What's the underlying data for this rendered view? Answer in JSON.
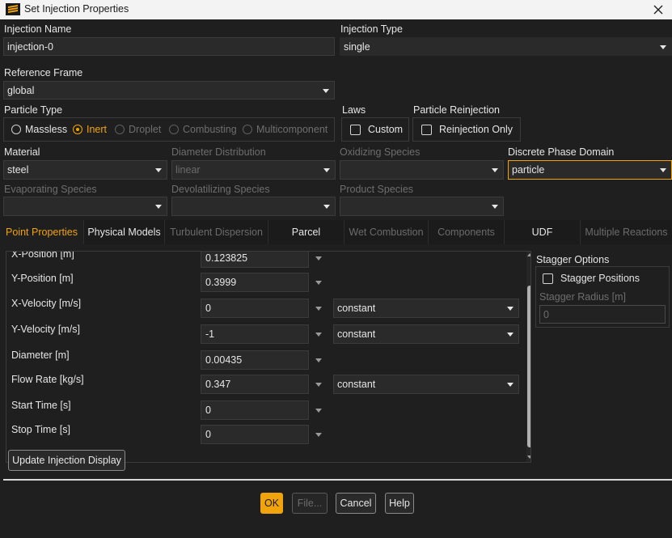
{
  "window": {
    "title": "Set Injection Properties"
  },
  "injection_name": {
    "label": "Injection Name",
    "value": "injection-0"
  },
  "injection_type": {
    "label": "Injection Type",
    "value": "single"
  },
  "reference_frame": {
    "label": "Reference Frame",
    "value": "global"
  },
  "particle_type": {
    "label": "Particle Type",
    "options": [
      "Massless",
      "Inert",
      "Droplet",
      "Combusting",
      "Multicomponent"
    ],
    "selected": "Inert"
  },
  "laws": {
    "label": "Laws",
    "custom_label": "Custom"
  },
  "particle_reinjection": {
    "label": "Particle Reinjection",
    "reinjection_only_label": "Reinjection Only"
  },
  "material": {
    "label": "Material",
    "value": "steel"
  },
  "diameter_distribution": {
    "label": "Diameter Distribution",
    "value": "linear"
  },
  "oxidizing_species": {
    "label": "Oxidizing Species",
    "value": ""
  },
  "discrete_phase_domain": {
    "label": "Discrete Phase Domain",
    "value": "particle"
  },
  "evaporating_species": {
    "label": "Evaporating Species",
    "value": ""
  },
  "devolatilizing_species": {
    "label": "Devolatilizing Species",
    "value": ""
  },
  "product_species": {
    "label": "Product Species",
    "value": ""
  },
  "tabs": [
    {
      "label": "Point Properties",
      "state": "active"
    },
    {
      "label": "Physical Models",
      "state": "enabled"
    },
    {
      "label": "Turbulent Dispersion",
      "state": "disabled"
    },
    {
      "label": "Parcel",
      "state": "enabled"
    },
    {
      "label": "Wet Combustion",
      "state": "disabled"
    },
    {
      "label": "Components",
      "state": "disabled"
    },
    {
      "label": "UDF",
      "state": "enabled"
    },
    {
      "label": "Multiple Reactions",
      "state": "disabled"
    }
  ],
  "point_properties": [
    {
      "label": "X-Position [m]",
      "value": "0.123825"
    },
    {
      "label": "Y-Position [m]",
      "value": "0.3999"
    },
    {
      "label": "X-Velocity [m/s]",
      "value": "0",
      "profile": "constant"
    },
    {
      "label": "Y-Velocity [m/s]",
      "value": "-1",
      "profile": "constant"
    },
    {
      "label": "Diameter [m]",
      "value": "0.00435"
    },
    {
      "label": "Flow Rate [kg/s]",
      "value": "0.347",
      "profile": "constant"
    },
    {
      "label": "Start Time [s]",
      "value": "0"
    },
    {
      "label": "Stop Time [s]",
      "value": "0"
    }
  ],
  "stagger_options": {
    "label": "Stagger Options",
    "stagger_positions_label": "Stagger Positions",
    "stagger_radius_label": "Stagger Radius [m]",
    "stagger_radius_value": "0"
  },
  "buttons": {
    "update_display": "Update Injection Display",
    "ok": "OK",
    "file": "File...",
    "cancel": "Cancel",
    "help": "Help"
  },
  "colors": {
    "accent": "#f0a30a",
    "background": "#1f1f1f",
    "field": "#2a2a2a",
    "disabled_text": "#6e6e6e"
  }
}
